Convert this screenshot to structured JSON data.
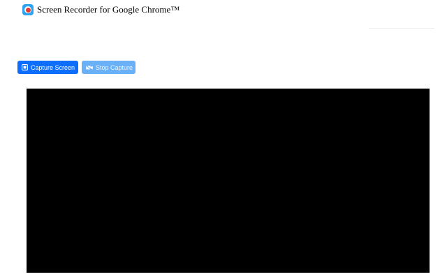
{
  "header": {
    "title": "Screen Recorder for Google Chrome™",
    "icon": "record-icon"
  },
  "toolbar": {
    "capture_label": "Capture Screen",
    "capture_icon": "screen-capture-icon",
    "stop_label": "Stop Capture",
    "stop_icon": "video-off-icon",
    "stop_disabled": true
  },
  "colors": {
    "primary": "#0d6efd",
    "primary_disabled": "#6ab0f7",
    "preview_background": "#000000",
    "record_red": "#e53935",
    "icon_blue": "#2ea3f2"
  }
}
